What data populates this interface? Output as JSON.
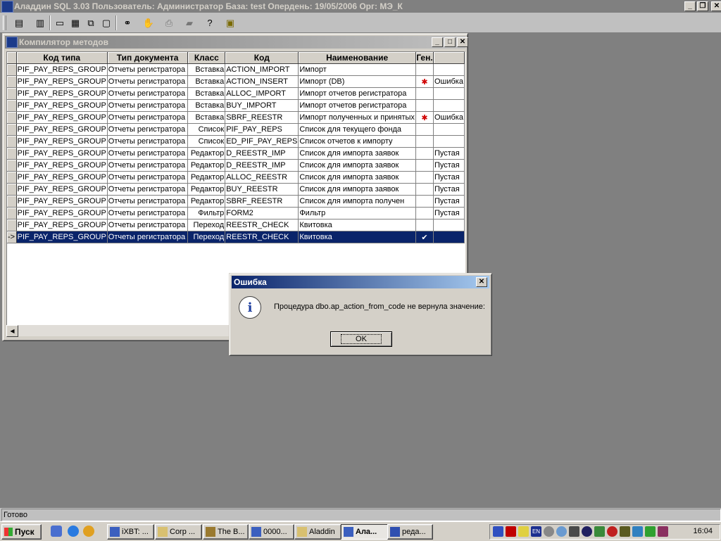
{
  "app": {
    "title": "Аладдин SQL 3.03 Пользователь: Администратор База: test Опердень: 19/05/2006 Орг: МЭ_К"
  },
  "compiler_window": {
    "title": "Компилятор методов",
    "columns": [
      "Код типа",
      "Тип документа",
      "Класс",
      "Код",
      "Наименование",
      "Ген.",
      ""
    ],
    "rows": [
      {
        "ind": "",
        "code_type": "PIF_PAY_REPS_GROUP",
        "doc_type": "Отчеты регистратора",
        "class": "Вставка",
        "code": "ACTION_IMPORT",
        "name": "Импорт",
        "gen": "",
        "extra": ""
      },
      {
        "ind": "",
        "code_type": "PIF_PAY_REPS_GROUP",
        "doc_type": "Отчеты регистратора",
        "class": "Вставка",
        "code": "ACTION_INSERT",
        "name": "Импорт (DB)",
        "gen": "✱",
        "extra": "Ошибка"
      },
      {
        "ind": "",
        "code_type": "PIF_PAY_REPS_GROUP",
        "doc_type": "Отчеты регистратора",
        "class": "Вставка",
        "code": "ALLOC_IMPORT",
        "name": "Импорт отчетов регистратора",
        "gen": "",
        "extra": ""
      },
      {
        "ind": "",
        "code_type": "PIF_PAY_REPS_GROUP",
        "doc_type": "Отчеты регистратора",
        "class": "Вставка",
        "code": "BUY_IMPORT",
        "name": "Импорт отчетов регистратора",
        "gen": "",
        "extra": ""
      },
      {
        "ind": "",
        "code_type": "PIF_PAY_REPS_GROUP",
        "doc_type": "Отчеты регистратора",
        "class": "Вставка",
        "code": "SBRF_REESTR",
        "name": "Импорт полученных и принятых",
        "gen": "✱",
        "extra": "Ошибка"
      },
      {
        "ind": "",
        "code_type": "PIF_PAY_REPS_GROUP",
        "doc_type": "Отчеты регистратора",
        "class": "Список",
        "code": "PIF_PAY_REPS",
        "name": "Список для текущего фонда",
        "gen": "",
        "extra": ""
      },
      {
        "ind": "",
        "code_type": "PIF_PAY_REPS_GROUP",
        "doc_type": "Отчеты регистратора",
        "class": "Список",
        "code": "ED_PIF_PAY_REPS",
        "name": "Список отчетов к импорту",
        "gen": "",
        "extra": ""
      },
      {
        "ind": "",
        "code_type": "PIF_PAY_REPS_GROUP",
        "doc_type": "Отчеты регистратора",
        "class": "Редактор",
        "code": "D_REESTR_IMP",
        "name": "Список для импорта заявок",
        "gen": "",
        "extra": "Пустая"
      },
      {
        "ind": "",
        "code_type": "PIF_PAY_REPS_GROUP",
        "doc_type": "Отчеты регистратора",
        "class": "Редактор",
        "code": "D_REESTR_IMP",
        "name": "Список для импорта заявок",
        "gen": "",
        "extra": "Пустая"
      },
      {
        "ind": "",
        "code_type": "PIF_PAY_REPS_GROUP",
        "doc_type": "Отчеты регистратора",
        "class": "Редактор",
        "code": "ALLOC_REESTR",
        "name": "Список для импорта заявок",
        "gen": "",
        "extra": "Пустая"
      },
      {
        "ind": "",
        "code_type": "PIF_PAY_REPS_GROUP",
        "doc_type": "Отчеты регистратора",
        "class": "Редактор",
        "code": "BUY_REESTR",
        "name": "Список для импорта заявок",
        "gen": "",
        "extra": "Пустая"
      },
      {
        "ind": "",
        "code_type": "PIF_PAY_REPS_GROUP",
        "doc_type": "Отчеты регистратора",
        "class": "Редактор",
        "code": "SBRF_REESTR",
        "name": "Список для импорта получен",
        "gen": "",
        "extra": "Пустая"
      },
      {
        "ind": "",
        "code_type": "PIF_PAY_REPS_GROUP",
        "doc_type": "Отчеты регистратора",
        "class": "Фильтр",
        "code": "FORM2",
        "name": "Фильтр",
        "gen": "",
        "extra": "Пустая"
      },
      {
        "ind": "",
        "code_type": "PIF_PAY_REPS_GROUP",
        "doc_type": "Отчеты регистратора",
        "class": "Переход",
        "code": "REESTR_CHECK",
        "name": "Квитовка",
        "gen": "",
        "extra": ""
      },
      {
        "ind": "->",
        "code_type": "PIF_PAY_REPS_GROUP",
        "doc_type": "Отчеты регистратора",
        "class": "Переход",
        "code": "REESTR_CHECK",
        "name": "Квитовка",
        "gen": "✔",
        "extra": ""
      }
    ],
    "selected_row": 14
  },
  "dialog": {
    "title": "Ошибка",
    "message": "Процедура dbo.ap_action_from_code не вернула значение:",
    "ok_label": "OK",
    "icon": "info-icon"
  },
  "status": {
    "text": "Готово"
  },
  "taskbar": {
    "start_label": "Пуск",
    "tasks": [
      {
        "label": "iXBT: ...",
        "active": false
      },
      {
        "label": "Corp ...",
        "active": false
      },
      {
        "label": "The B...",
        "active": false
      },
      {
        "label": "0000...",
        "active": false
      },
      {
        "label": "Aladdin",
        "active": false
      },
      {
        "label": "Ала...",
        "active": true
      },
      {
        "label": "реда...",
        "active": false
      }
    ],
    "tray_lang": "EN",
    "clock": "16:04"
  },
  "colors": {
    "selection": "#0a246a",
    "window_face": "#d4d0c8",
    "mdi_background": "#808080",
    "error_star": "#d00000"
  }
}
